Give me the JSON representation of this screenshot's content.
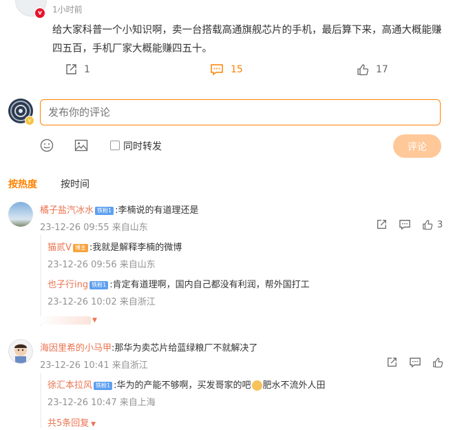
{
  "post": {
    "time": "1小时前",
    "text": "给大家科普一个小知识啊，卖一台搭载高通旗舰芯片的手机，最后算下来，高通大概能赚四五百，手机厂家大概能赚四五十。",
    "repost_count": "1",
    "comment_count": "15",
    "like_count": "17"
  },
  "composer": {
    "placeholder": "发布你的评论",
    "repost_label": "同时转发",
    "submit_label": "评论"
  },
  "sort": {
    "hot": "按热度",
    "time": "按时间"
  },
  "comments": [
    {
      "name": "橘子盐汽冰水",
      "badge": "铁粉1",
      "text": ":李楠说的有道理还是",
      "meta": "23-12-26 09:55 来自山东",
      "like_count": "3",
      "replies": [
        {
          "name": "猫贰V",
          "badge": "博主",
          "text": ":我就是解释李楠的微博",
          "meta": "23-12-26 09:56 来自山东"
        },
        {
          "name": "也子行ing",
          "badge": "铁粉1",
          "text": ":肯定有道理啊，国内自己都没有利润，帮外国打工",
          "meta": "23-12-26 10:02 来自浙江"
        }
      ]
    },
    {
      "name": "海因里希的小马甲",
      "text": ":那华为卖芯片给蓝绿粮厂不就解决了",
      "meta": "23-12-26 10:41 来自浙江",
      "replies": [
        {
          "name": "徐汇本拉风",
          "badge": "铁粉1",
          "text_a": ":华为的产能不够啊，买发哥家的吧",
          "text_b": "肥水不流外人田",
          "meta": "23-12-26 10:47 来自上海"
        }
      ],
      "more_replies": "共5条回复"
    }
  ],
  "colors": {
    "accent": "#ff8200",
    "name": "#eb7350",
    "meta": "#939393",
    "fan_badge": "#5ea0f0",
    "blogger_badge": "#f7a33b"
  }
}
